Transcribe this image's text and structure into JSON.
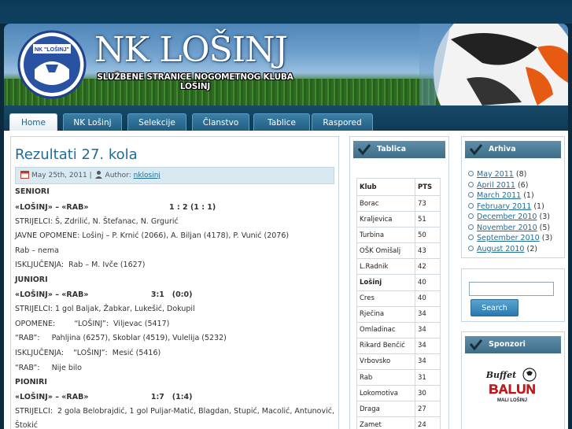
{
  "header": {
    "title": "NK LOŠINJ",
    "subtitle": "SLUŽBENE STRANICE NOGOMETNOG KLUBA LOŠINJ",
    "logo_text": "NK \"LOŠINJ\""
  },
  "nav": [
    "Home",
    "NK Lošinj",
    "Selekcije",
    "Članstvo",
    "Tablice",
    "Raspored"
  ],
  "post": {
    "title": "Rezultati 27. kola",
    "date": "May 25th, 2011",
    "author_label": "Author:",
    "author": "nklosinj",
    "lines": [
      {
        "t": "SENIORI",
        "cls": "b"
      },
      {
        "t": "«LOŠINJ» – «RAB»                               1 : 2 (1 : 1)",
        "cls": "b"
      },
      {
        "t": "STRIJELCI: Š, Zdrilić, N. Štefanac, N. Grgurić",
        "cls": ""
      },
      {
        "t": "JAVNE OPOMENE: Lošinj – P. Krnić (2066), A. Biljan (4178), P. Vunić (2076)",
        "cls": ""
      },
      {
        "t": "Rab – nema",
        "cls": ""
      },
      {
        "t": "ISKLJUČENJA:  Rab – M. Ivče (1627)",
        "cls": ""
      },
      {
        "t": "JUNIORI",
        "cls": "b"
      },
      {
        "t": "«LOŠINJ» – «RAB»                        3:1   (0:0)",
        "cls": "b"
      },
      {
        "t": "STRIJELCI: 1 gol Baljak, Žabkar, Lukešić, Dokupil",
        "cls": ""
      },
      {
        "t": "OPOMENE:        “LOŠINJ”:  Viljevac (5417)",
        "cls": ""
      },
      {
        "t": "“RAB”:     Pahljina (6257), Skoblar (4519), Vulelija (5232)",
        "cls": ""
      },
      {
        "t": "ISKLJUČENJA:    “LOŠINJ”:  Mesić (5416)",
        "cls": ""
      },
      {
        "t": "“RAB”:     Nije bilo",
        "cls": ""
      },
      {
        "t": "PIONIRI",
        "cls": "b"
      },
      {
        "t": "«LOŠINJ» – «RAB»                        1:7   (1:4)",
        "cls": "b"
      },
      {
        "t": "STRIJELCI:  2 gola Belobrajdić, 1 gol Puljar-Matić, Blagdan, Stupić, Macolić, Antunović,",
        "cls": ""
      },
      {
        "t": "Štokić",
        "cls": ""
      }
    ]
  },
  "tablica": {
    "title": "Tablica",
    "headers": [
      "Klub",
      "PTS"
    ],
    "rows": [
      [
        "Borac",
        "73"
      ],
      [
        "Kraljevica",
        "51"
      ],
      [
        "Turbina",
        "50"
      ],
      [
        "OŠK Omišalj",
        "43"
      ],
      [
        "L.Radnik",
        "42"
      ],
      [
        "Lošinj",
        "40"
      ],
      [
        "Cres",
        "40"
      ],
      [
        "Rječina",
        "34"
      ],
      [
        "Omladinac",
        "34"
      ],
      [
        "Rikard Benčić",
        "34"
      ],
      [
        "Vrbovsko",
        "34"
      ],
      [
        "Rab",
        "31"
      ],
      [
        "Lokomotiva",
        "30"
      ],
      [
        "Draga",
        "27"
      ],
      [
        "Zamet",
        "24"
      ]
    ]
  },
  "arhiva": {
    "title": "Arhiva",
    "items": [
      {
        "label": "May 2011",
        "count": "(8)"
      },
      {
        "label": "April 2011",
        "count": "(6)"
      },
      {
        "label": "March 2011",
        "count": "(1)"
      },
      {
        "label": "February 2011",
        "count": "(1)"
      },
      {
        "label": "December 2010",
        "count": "(3)"
      },
      {
        "label": "November 2010",
        "count": "(5)"
      },
      {
        "label": "September 2010",
        "count": "(3)"
      },
      {
        "label": "August 2010",
        "count": "(2)"
      }
    ]
  },
  "search": {
    "button": "Search",
    "value": ""
  },
  "sponzori": {
    "title": "Sponzori",
    "sponsor_top": "Buffet",
    "sponsor_name": "BALUN",
    "sponsor_sub": "MALI LOŠINJ"
  },
  "colors": {
    "accent": "#1f6c97",
    "nav": "#225e82",
    "widget_title": "#4a7b96"
  }
}
